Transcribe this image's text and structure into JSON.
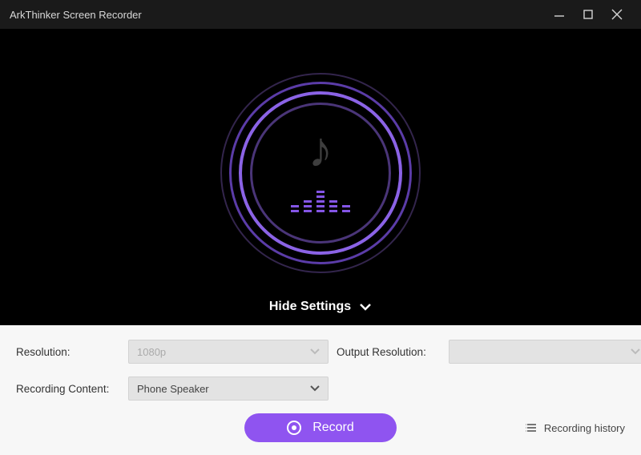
{
  "window": {
    "title": "ArkThinker Screen Recorder"
  },
  "toggle": {
    "label": "Hide Settings"
  },
  "settings": {
    "resolution_label": "Resolution:",
    "resolution_value": "1080p",
    "output_label": "Output Resolution:",
    "output_value": "",
    "content_label": "Recording Content:",
    "content_value": "Phone Speaker"
  },
  "actions": {
    "record_label": "Record",
    "history_label": "Recording history"
  }
}
